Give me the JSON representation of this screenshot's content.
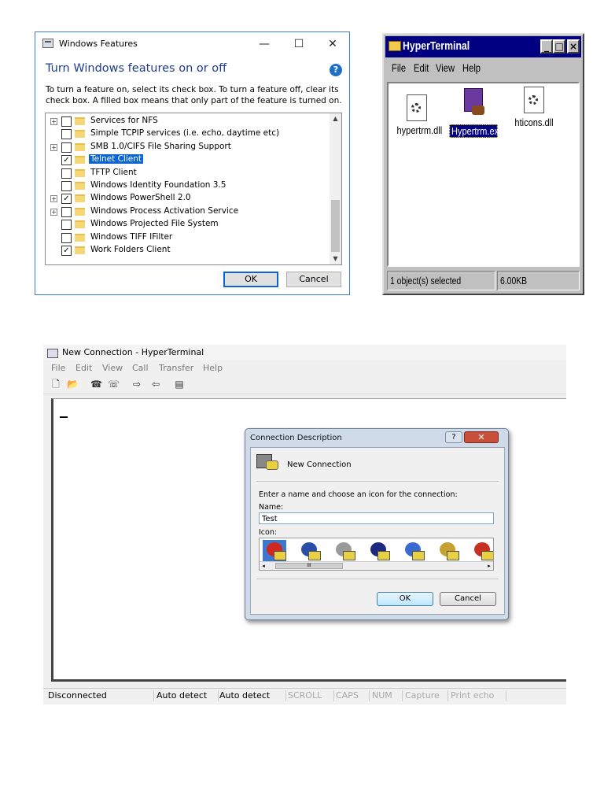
{
  "windows_features": {
    "title": "Windows Features",
    "minimize_glyph": "—",
    "maximize_glyph": "☐",
    "close_glyph": "✕",
    "heading": "Turn Windows features on or off",
    "help_glyph": "?",
    "description": "To turn a feature on, select its check box. To turn a feature off, clear its check box. A filled box means that only part of the feature is turned on.",
    "features": [
      {
        "label": "Services for NFS",
        "expandable": true,
        "checked": false,
        "selected": false
      },
      {
        "label": "Simple TCPIP services (i.e. echo, daytime etc)",
        "expandable": false,
        "checked": false,
        "selected": false
      },
      {
        "label": "SMB 1.0/CIFS File Sharing Support",
        "expandable": true,
        "checked": false,
        "selected": false
      },
      {
        "label": "Telnet Client",
        "expandable": false,
        "checked": true,
        "selected": true
      },
      {
        "label": "TFTP Client",
        "expandable": false,
        "checked": false,
        "selected": false
      },
      {
        "label": "Windows Identity Foundation 3.5",
        "expandable": false,
        "checked": false,
        "selected": false
      },
      {
        "label": "Windows PowerShell 2.0",
        "expandable": true,
        "checked": true,
        "selected": false
      },
      {
        "label": "Windows Process Activation Service",
        "expandable": true,
        "checked": false,
        "selected": false
      },
      {
        "label": "Windows Projected File System",
        "expandable": false,
        "checked": false,
        "selected": false
      },
      {
        "label": "Windows TIFF IFilter",
        "expandable": false,
        "checked": false,
        "selected": false
      },
      {
        "label": "Work Folders Client",
        "expandable": false,
        "checked": true,
        "selected": false
      }
    ],
    "ok_label": "OK",
    "cancel_label": "Cancel"
  },
  "hyperterminal_folder": {
    "title": "HyperTerminal",
    "min_glyph": "_",
    "max_glyph": "□",
    "close_glyph": "×",
    "menus": [
      "File",
      "Edit",
      "View",
      "Help"
    ],
    "files": [
      {
        "name": "hypertrm.dll",
        "kind": "dll",
        "selected": false
      },
      {
        "name": "Hypertrm.exe",
        "kind": "exe",
        "selected": true
      },
      {
        "name": "hticons.dll",
        "kind": "dll",
        "selected": false
      }
    ],
    "status_selected": "1 object(s) selected",
    "status_size": "6.00KB"
  },
  "new_connection_window": {
    "title": "New Connection - HyperTerminal",
    "menus": [
      "File",
      "Edit",
      "View",
      "Call",
      "Transfer",
      "Help"
    ],
    "toolbar_icons": [
      "new-icon",
      "open-icon",
      "call-icon",
      "disconnect-icon",
      "send-icon",
      "receive-icon",
      "properties-icon"
    ],
    "status": [
      "Disconnected",
      "Auto detect",
      "Auto detect",
      "SCROLL",
      "CAPS",
      "NUM",
      "Capture",
      "Print echo"
    ],
    "dialog": {
      "title": "Connection Description",
      "help_glyph": "?",
      "close_glyph": "✕",
      "connection_label": "New Connection",
      "prompt": "Enter a name and choose an icon for the connection:",
      "name_label": "Name:",
      "name_value": "Test",
      "icon_label": "Icon:",
      "scroll_thumb_glyph": "III",
      "scroll_left_glyph": "◂",
      "scroll_right_glyph": "▸",
      "icons": [
        {
          "name": "red-phone-icon",
          "color": "#d0281e"
        },
        {
          "name": "blue-globe-icon",
          "color": "#2a4ea8"
        },
        {
          "name": "gray-phone-icon",
          "color": "#9a9a9a"
        },
        {
          "name": "mci-icon",
          "color": "#1b2a80"
        },
        {
          "name": "earth-globe-icon",
          "color": "#3a6ad0"
        },
        {
          "name": "document-phone-icon",
          "color": "#c8a030"
        },
        {
          "name": "umbrella-icon",
          "color": "#c83020"
        }
      ],
      "ok_label": "OK",
      "cancel_label": "Cancel"
    }
  }
}
